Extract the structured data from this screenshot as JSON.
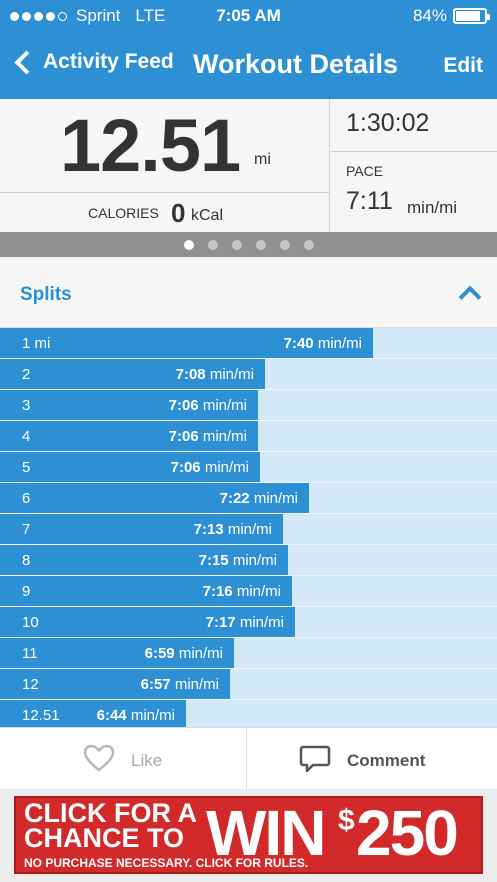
{
  "status_bar": {
    "carrier": "Sprint",
    "network": "LTE",
    "time": "7:05 AM",
    "battery": "84%",
    "battery_level": 0.84
  },
  "nav": {
    "back_label": "Activity Feed",
    "title": "Workout Details",
    "edit_label": "Edit"
  },
  "summary": {
    "distance": "12.51",
    "distance_unit": "mi",
    "calories_label": "CALORIES",
    "calories_value": "0",
    "calories_unit": "kCal",
    "duration": "1:30:02",
    "pace_label": "PACE",
    "pace_value": "7:11",
    "pace_unit": "min/mi"
  },
  "pager": {
    "count": 6,
    "active": 0
  },
  "splits": {
    "title": "Splits",
    "unit": "min/mi",
    "rows": [
      {
        "label": "1 mi",
        "pace": "7:40",
        "bar_fraction": 0.75
      },
      {
        "label": "2",
        "pace": "7:08",
        "bar_fraction": 0.533
      },
      {
        "label": "3",
        "pace": "7:06",
        "bar_fraction": 0.519
      },
      {
        "label": "4",
        "pace": "7:06",
        "bar_fraction": 0.519
      },
      {
        "label": "5",
        "pace": "7:06",
        "bar_fraction": 0.523
      },
      {
        "label": "6",
        "pace": "7:22",
        "bar_fraction": 0.622
      },
      {
        "label": "7",
        "pace": "7:13",
        "bar_fraction": 0.57
      },
      {
        "label": "8",
        "pace": "7:15",
        "bar_fraction": 0.579
      },
      {
        "label": "9",
        "pace": "7:16",
        "bar_fraction": 0.588
      },
      {
        "label": "10",
        "pace": "7:17",
        "bar_fraction": 0.594
      },
      {
        "label": "11",
        "pace": "6:59",
        "bar_fraction": 0.471
      },
      {
        "label": "12",
        "pace": "6:57",
        "bar_fraction": 0.463
      },
      {
        "label": "12.51",
        "pace": "6:44",
        "bar_fraction": 0.374
      }
    ]
  },
  "actions": {
    "like_label": "Like",
    "comment_label": "Comment"
  },
  "ad": {
    "line1": "CLICK FOR A",
    "line2": "CHANCE TO",
    "win": "WIN",
    "dollar": "$",
    "amount": "250",
    "fine_print": "NO PURCHASE NECESSARY. CLICK FOR RULES."
  },
  "colors": {
    "brand_blue": "#2d8fd4",
    "bar_bg": "#d4e9f7",
    "ad_red": "#d22a2a"
  }
}
